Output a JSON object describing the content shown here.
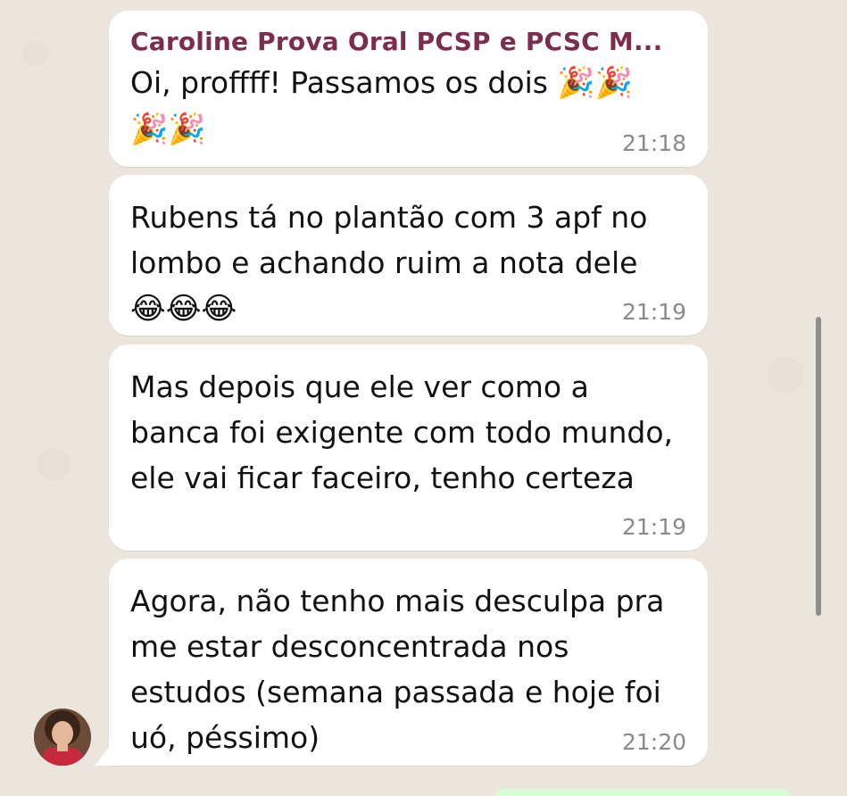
{
  "messages": [
    {
      "sender": "Caroline Prova Oral PCSP e PCSC M...",
      "text": "Oi, proffff! Passamos os dois ",
      "emoji_line": "🎉🎉",
      "emoji_line2": "🎉🎉",
      "time": "21:18"
    },
    {
      "text": "Rubens tá no plantão com 3 apf no lombo e achando ruim a nota dele",
      "emoji_line": "😂😂😂",
      "time": "21:19"
    },
    {
      "text": "Mas depois que ele ver como a banca foi exigente com todo mundo, ele vai ficar faceiro, tenho certeza",
      "time": "21:19"
    },
    {
      "text": "Agora, não tenho mais desculpa pra me estar desconcentrada nos estudos (semana passada e hoje foi uó, péssimo)",
      "time": "21:20"
    }
  ],
  "colors": {
    "sender_name": "#7b2d4e",
    "bubble": "#ffffff",
    "background": "#ebe5dd",
    "timestamp": "#8a8a8a"
  }
}
